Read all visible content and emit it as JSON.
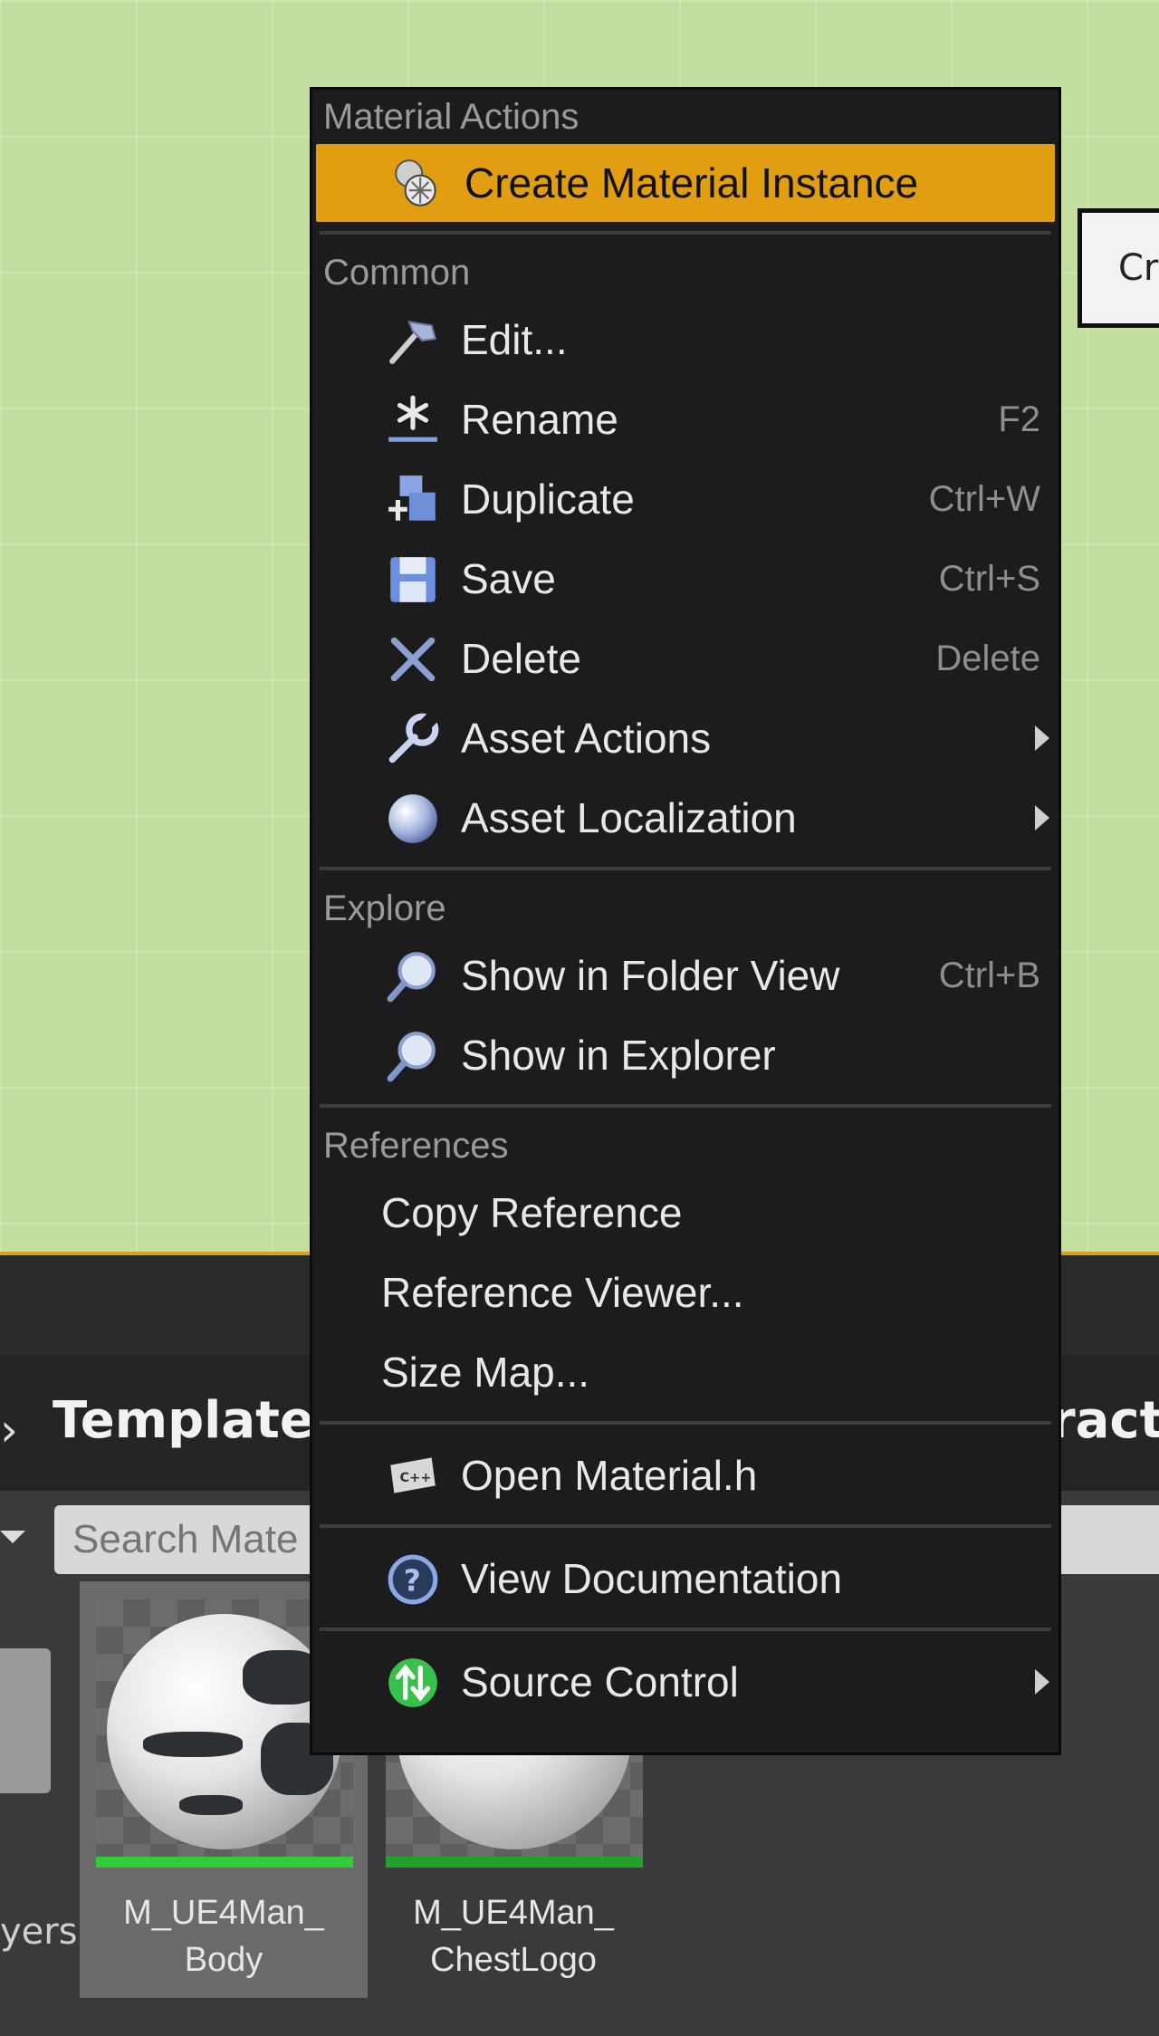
{
  "viewport": {
    "side_button_label": "Cre"
  },
  "content_browser": {
    "path_left": "TemplateC",
    "path_right": "ract",
    "search_placeholder": "Search Mate",
    "folder_label": "yers",
    "assets": [
      {
        "line1": "M_UE4Man_",
        "line2": "Body",
        "selected": true
      },
      {
        "line1": "M_UE4Man_",
        "line2": "ChestLogo",
        "selected": false
      }
    ]
  },
  "menu": {
    "sections": {
      "material_actions": "Material Actions",
      "common": "Common",
      "explore": "Explore",
      "references": "References"
    },
    "items": {
      "create_material_instance": {
        "label": "Create Material Instance",
        "icon": "material-instance-icon"
      },
      "edit": {
        "label": "Edit...",
        "icon": "hammer-icon"
      },
      "rename": {
        "label": "Rename",
        "shortcut": "F2",
        "icon": "rename-icon"
      },
      "duplicate": {
        "label": "Duplicate",
        "shortcut": "Ctrl+W",
        "icon": "duplicate-icon"
      },
      "save": {
        "label": "Save",
        "shortcut": "Ctrl+S",
        "icon": "save-icon"
      },
      "delete": {
        "label": "Delete",
        "shortcut": "Delete",
        "icon": "delete-icon"
      },
      "asset_actions": {
        "label": "Asset Actions",
        "icon": "wrench-icon",
        "submenu": true
      },
      "asset_localization": {
        "label": "Asset Localization",
        "icon": "globe-icon",
        "submenu": true
      },
      "show_in_folder_view": {
        "label": "Show in Folder View",
        "shortcut": "Ctrl+B",
        "icon": "magnifier-icon"
      },
      "show_in_explorer": {
        "label": "Show in Explorer",
        "icon": "magnifier-icon"
      },
      "copy_reference": {
        "label": "Copy Reference"
      },
      "reference_viewer": {
        "label": "Reference Viewer..."
      },
      "size_map": {
        "label": "Size Map..."
      },
      "open_material_h": {
        "label": "Open Material.h",
        "icon": "cpp-file-icon"
      },
      "view_documentation": {
        "label": "View Documentation",
        "icon": "help-icon"
      },
      "source_control": {
        "label": "Source Control",
        "icon": "source-control-icon",
        "submenu": true
      }
    }
  },
  "colors": {
    "highlight": "#e09e10",
    "menu_bg": "#1c1c1c",
    "viewport_bg": "#c3dea0",
    "asset_bar": "#2fcc3c"
  }
}
